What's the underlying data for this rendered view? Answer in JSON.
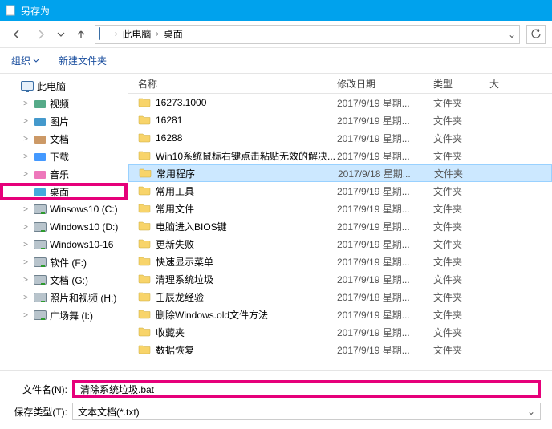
{
  "title": "另存为",
  "breadcrumb": {
    "root": "此电脑",
    "current": "桌面"
  },
  "toolbar": {
    "organize": "组织",
    "newfolder": "新建文件夹"
  },
  "columns": {
    "name": "名称",
    "date": "修改日期",
    "type": "类型",
    "size": "大"
  },
  "tree": [
    {
      "label": "此电脑",
      "icon": "pc",
      "level": 0,
      "exp": "",
      "selected": false
    },
    {
      "label": "视频",
      "icon": "video",
      "level": 1,
      "exp": ">",
      "selected": false
    },
    {
      "label": "图片",
      "icon": "pictures",
      "level": 1,
      "exp": ">",
      "selected": false
    },
    {
      "label": "文档",
      "icon": "docs",
      "level": 1,
      "exp": ">",
      "selected": false
    },
    {
      "label": "下载",
      "icon": "downloads",
      "level": 1,
      "exp": ">",
      "selected": false
    },
    {
      "label": "音乐",
      "icon": "music",
      "level": 1,
      "exp": ">",
      "selected": false
    },
    {
      "label": "桌面",
      "icon": "desktop",
      "level": 1,
      "exp": "",
      "selected": true
    },
    {
      "label": "Winsows10 (C:)",
      "icon": "drive",
      "level": 1,
      "exp": ">",
      "selected": false
    },
    {
      "label": "Windows10 (D:)",
      "icon": "drive",
      "level": 1,
      "exp": ">",
      "selected": false
    },
    {
      "label": "Windows10-16",
      "icon": "drive",
      "level": 1,
      "exp": ">",
      "selected": false
    },
    {
      "label": "软件 (F:)",
      "icon": "drive",
      "level": 1,
      "exp": ">",
      "selected": false
    },
    {
      "label": "文档 (G:)",
      "icon": "drive",
      "level": 1,
      "exp": ">",
      "selected": false
    },
    {
      "label": "照片和视频 (H:)",
      "icon": "drive",
      "level": 1,
      "exp": ">",
      "selected": false
    },
    {
      "label": "广场舞 (I:)",
      "icon": "drive",
      "level": 1,
      "exp": ">",
      "selected": false
    }
  ],
  "files": [
    {
      "name": "16273.1000",
      "date": "2017/9/19 星期...",
      "type": "文件夹",
      "selected": false
    },
    {
      "name": "16281",
      "date": "2017/9/19 星期...",
      "type": "文件夹",
      "selected": false
    },
    {
      "name": "16288",
      "date": "2017/9/19 星期...",
      "type": "文件夹",
      "selected": false
    },
    {
      "name": "Win10系统鼠标右键点击粘贴无效的解决...",
      "date": "2017/9/19 星期...",
      "type": "文件夹",
      "selected": false
    },
    {
      "name": "常用程序",
      "date": "2017/9/18 星期...",
      "type": "文件夹",
      "selected": true
    },
    {
      "name": "常用工具",
      "date": "2017/9/19 星期...",
      "type": "文件夹",
      "selected": false
    },
    {
      "name": "常用文件",
      "date": "2017/9/19 星期...",
      "type": "文件夹",
      "selected": false
    },
    {
      "name": "电脑进入BIOS键",
      "date": "2017/9/19 星期...",
      "type": "文件夹",
      "selected": false
    },
    {
      "name": "更新失败",
      "date": "2017/9/19 星期...",
      "type": "文件夹",
      "selected": false
    },
    {
      "name": "快速显示菜单",
      "date": "2017/9/19 星期...",
      "type": "文件夹",
      "selected": false
    },
    {
      "name": "清理系统垃圾",
      "date": "2017/9/19 星期...",
      "type": "文件夹",
      "selected": false
    },
    {
      "name": "壬辰龙经验",
      "date": "2017/9/18 星期...",
      "type": "文件夹",
      "selected": false
    },
    {
      "name": "删除Windows.old文件方法",
      "date": "2017/9/19 星期...",
      "type": "文件夹",
      "selected": false
    },
    {
      "name": "收藏夹",
      "date": "2017/9/19 星期...",
      "type": "文件夹",
      "selected": false
    },
    {
      "name": "数据恢复",
      "date": "2017/9/19 星期...",
      "type": "文件夹",
      "selected": false
    }
  ],
  "form": {
    "filename_label": "文件名(N):",
    "filename_value": "清除系统垃圾.bat",
    "filetype_label": "保存类型(T):",
    "filetype_value": "文本文档(*.txt)"
  }
}
